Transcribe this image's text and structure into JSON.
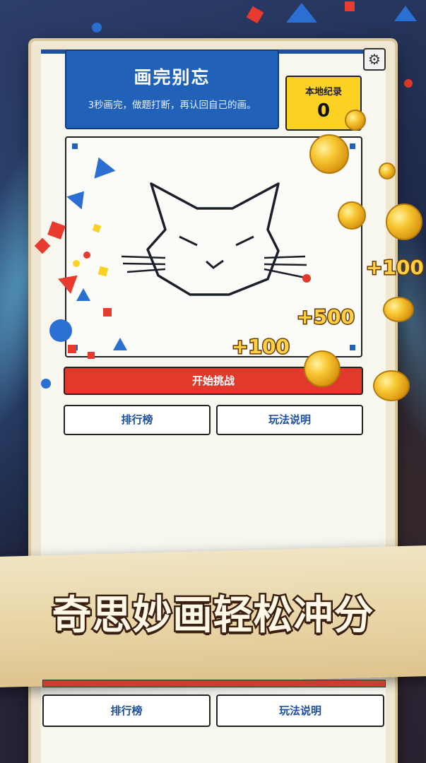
{
  "game": {
    "title": "画完别忘",
    "description": "3秒画完，做题打断，再认回自己的画。"
  },
  "record": {
    "label": "本地纪录",
    "value": "0"
  },
  "settings_icon": "gear-icon",
  "buttons": {
    "start": "开始挑战",
    "leaderboard": "排行榜",
    "howto": "玩法说明"
  },
  "bottom_buttons": {
    "leaderboard": "排行榜",
    "howto": "玩法说明"
  },
  "banner": {
    "slogan": "奇思妙画轻松冲分"
  },
  "score_popups": [
    "+100",
    "+500",
    "+100"
  ],
  "colors": {
    "title_blue": "#2162b8",
    "record_yellow": "#fbd224",
    "start_red": "#e13a2d",
    "button_text": "#1e4f9c"
  }
}
